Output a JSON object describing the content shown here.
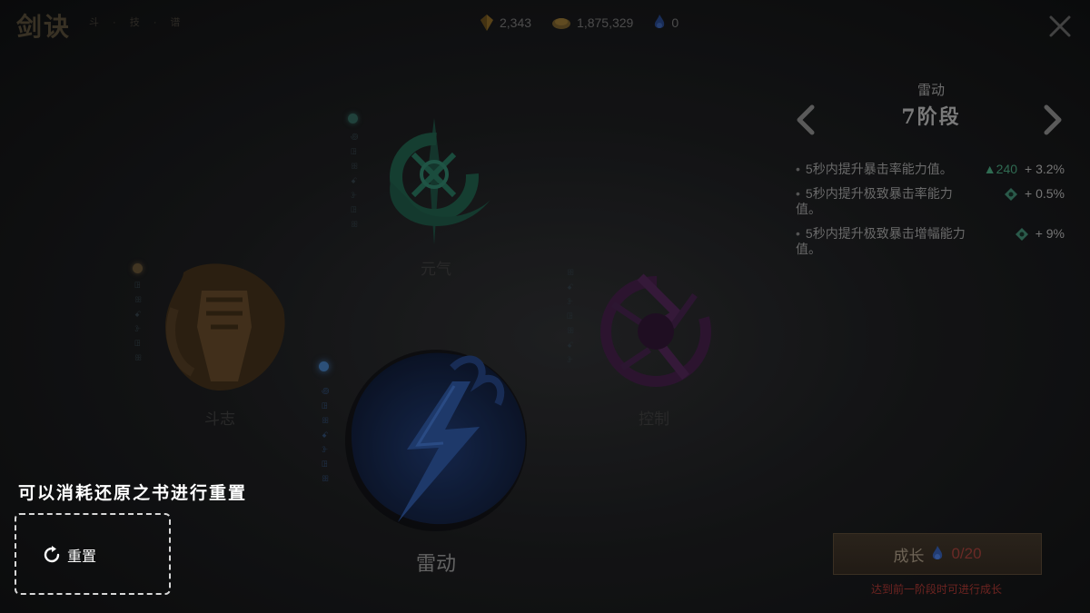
{
  "header": {
    "logo_text": "剑诀",
    "logo_sub": "斗 · 技 · 谱"
  },
  "currencies": [
    {
      "icon": "crystal-icon",
      "value": "2,343",
      "color": "#8a6a2a"
    },
    {
      "icon": "coin-pouch-icon",
      "value": "1,875,329",
      "color": "#7a6232"
    },
    {
      "icon": "blue-flame-icon",
      "value": "0",
      "color": "#2a4f8f"
    }
  ],
  "nodes": {
    "yuanqi": {
      "label": "元气",
      "color": "#1f5a48"
    },
    "douzhi": {
      "label": "斗志",
      "color": "#5e4524"
    },
    "kongzhi": {
      "label": "控制",
      "color": "#4e2552"
    },
    "leidong": {
      "label": "雷动",
      "color": "#1f3a6e"
    }
  },
  "panel": {
    "skill_name": "雷动",
    "stage": "7阶段",
    "stats": [
      {
        "desc": "5秒内提升暴击率能力值。",
        "up": "240",
        "pct": "+ 3.2%"
      },
      {
        "desc": "5秒内提升极致暴击率能力值。",
        "up": "",
        "pct": "+ 0.5%"
      },
      {
        "desc": "5秒内提升极致暴击增幅能力值。",
        "up": "",
        "pct": "+ 9%"
      }
    ],
    "grow_label": "成长",
    "grow_count": "0/20",
    "grow_hint": "达到前一阶段时可进行成长"
  },
  "reset": {
    "tip": "可以消耗还原之书进行重置",
    "button_label": "重置"
  }
}
